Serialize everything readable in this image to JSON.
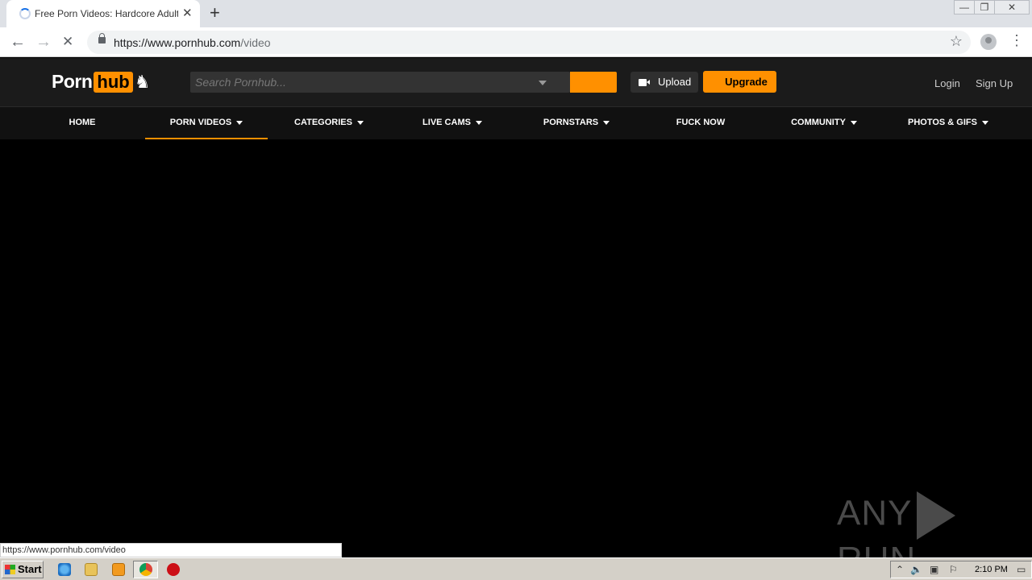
{
  "browser": {
    "tab_title": "Free Porn Videos: Hardcore Adult Sex",
    "tab_close": "✕",
    "new_tab": "+",
    "window_controls": {
      "minimize": "—",
      "restore": "❐",
      "close": "✕"
    },
    "back": "←",
    "forward": "→",
    "stop": "✕",
    "url_host": "https://www.pornhub.com",
    "url_path": "/video",
    "bookmark_star": "☆",
    "menu": "⋮",
    "status_url": "https://www.pornhub.com/video"
  },
  "site": {
    "logo": {
      "porn": "Porn",
      "hub": "hub",
      "mascot": "♞"
    },
    "search": {
      "placeholder": "Search Pornhub..."
    },
    "upload_label": "Upload",
    "upgrade_label": "Upgrade",
    "login_label": "Login",
    "signup_label": "Sign Up",
    "accent": "#ff9000",
    "nav": [
      {
        "label": "HOME",
        "dropdown": false
      },
      {
        "label": "PORN VIDEOS",
        "dropdown": true,
        "active": true
      },
      {
        "label": "CATEGORIES",
        "dropdown": true
      },
      {
        "label": "LIVE CAMS",
        "dropdown": true
      },
      {
        "label": "PORNSTARS",
        "dropdown": true
      },
      {
        "label": "FUCK NOW",
        "dropdown": false
      },
      {
        "label": "COMMUNITY",
        "dropdown": true
      },
      {
        "label": "PHOTOS & GIFS",
        "dropdown": true
      }
    ]
  },
  "watermark": {
    "left": "ANY",
    "right": "RUN"
  },
  "taskbar": {
    "start_label": "Start",
    "clock": "2:10 PM",
    "icons": [
      "ie-icon",
      "folder-icon",
      "media-player-icon",
      "chrome-icon",
      "opera-icon"
    ]
  }
}
